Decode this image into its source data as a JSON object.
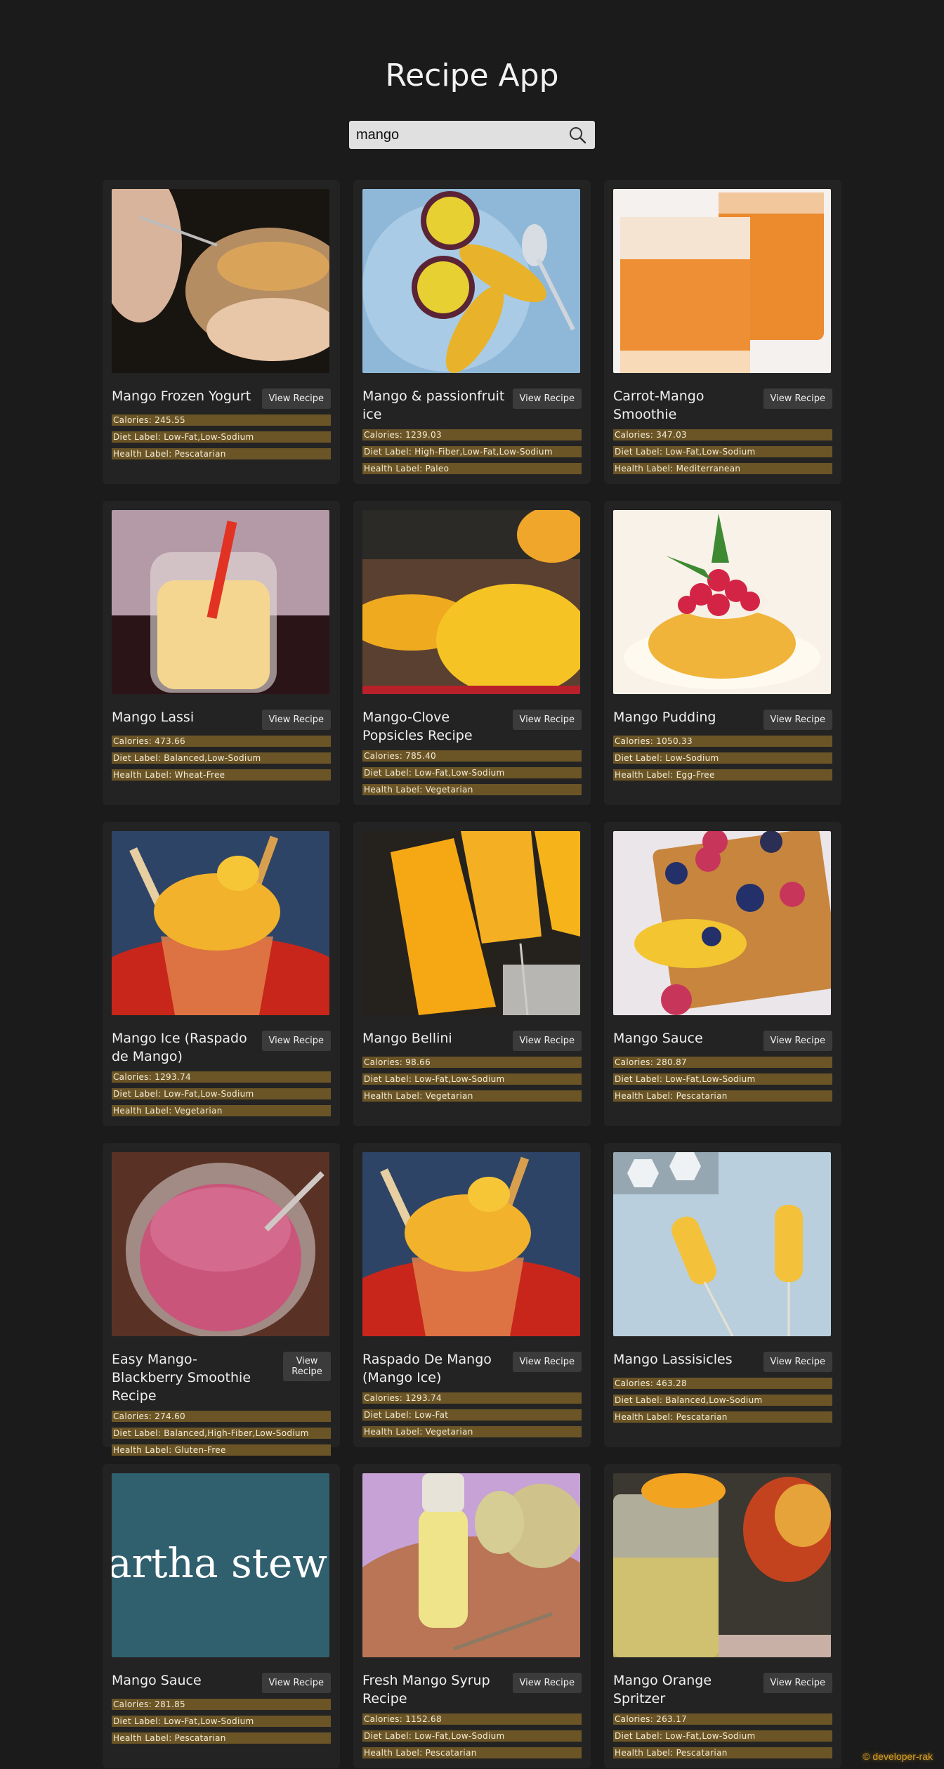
{
  "app": {
    "title": "Recipe App"
  },
  "search": {
    "value": "mango"
  },
  "colors": {
    "background": "#1b1b1b",
    "card": "#232323",
    "label_bg": "#6b5526",
    "button": "#3b3b3b",
    "footer": "#d8a021"
  },
  "recipes": [
    {
      "name": "Mango Frozen Yogurt",
      "button": "View Recipe",
      "calories": "Calories: 245.55",
      "diet": "Diet Label: Low-Fat,Low-Sodium",
      "health": "Health Label: Pescatarian"
    },
    {
      "name": "Mango & passionfruit ice",
      "button": "View Recipe",
      "calories": "Calories: 1239.03",
      "diet": "Diet Label: High-Fiber,Low-Fat,Low-Sodium",
      "health": "Health Label: Paleo"
    },
    {
      "name": "Carrot-Mango Smoothie",
      "button": "View Recipe",
      "calories": "Calories: 347.03",
      "diet": "Diet Label: Low-Fat,Low-Sodium",
      "health": "Health Label: Mediterranean"
    },
    {
      "name": "Mango Lassi",
      "button": "View Recipe",
      "calories": "Calories: 473.66",
      "diet": "Diet Label: Balanced,Low-Sodium",
      "health": "Health Label: Wheat-Free"
    },
    {
      "name": "Mango-Clove Popsicles Recipe",
      "button": "View Recipe",
      "calories": "Calories: 785.40",
      "diet": "Diet Label: Low-Fat,Low-Sodium",
      "health": "Health Label: Vegetarian"
    },
    {
      "name": "Mango Pudding",
      "button": "View Recipe",
      "calories": "Calories: 1050.33",
      "diet": "Diet Label: Low-Sodium",
      "health": "Health Label: Egg-Free"
    },
    {
      "name": "Mango Ice (Raspado de Mango)",
      "button": "View Recipe",
      "calories": "Calories: 1293.74",
      "diet": "Diet Label: Low-Fat,Low-Sodium",
      "health": "Health Label: Vegetarian"
    },
    {
      "name": "Mango Bellini",
      "button": "View Recipe",
      "calories": "Calories: 98.66",
      "diet": "Diet Label: Low-Fat,Low-Sodium",
      "health": "Health Label: Vegetarian"
    },
    {
      "name": "Mango Sauce",
      "button": "View Recipe",
      "calories": "Calories: 280.87",
      "diet": "Diet Label: Low-Fat,Low-Sodium",
      "health": "Health Label: Pescatarian"
    },
    {
      "name": "Easy Mango-Blackberry Smoothie Recipe",
      "button": "View Recipe",
      "calories": "Calories: 274.60",
      "diet": "Diet Label: Balanced,High-Fiber,Low-Sodium",
      "health": "Health Label: Gluten-Free"
    },
    {
      "name": "Raspado De Mango (Mango Ice)",
      "button": "View Recipe",
      "calories": "Calories: 1293.74",
      "diet": "Diet Label: Low-Fat",
      "health": "Health Label: Vegetarian"
    },
    {
      "name": "Mango Lassisicles",
      "button": "View Recipe",
      "calories": "Calories: 463.28",
      "diet": "Diet Label: Balanced,Low-Sodium",
      "health": "Health Label: Pescatarian"
    },
    {
      "name": "Mango Sauce",
      "button": "View Recipe",
      "calories": "Calories: 281.85",
      "diet": "Diet Label: Low-Fat,Low-Sodium",
      "health": "Health Label: Pescatarian",
      "image_text": "artha stewa"
    },
    {
      "name": "Fresh Mango Syrup Recipe",
      "button": "View Recipe",
      "calories": "Calories: 1152.68",
      "diet": "Diet Label: Low-Fat,Low-Sodium",
      "health": "Health Label: Pescatarian"
    },
    {
      "name": "Mango Orange Spritzer",
      "button": "View Recipe",
      "calories": "Calories: 263.17",
      "diet": "Diet Label: Low-Fat,Low-Sodium",
      "health": "Health Label: Pescatarian"
    }
  ],
  "footer": {
    "credit": "© developer-rak"
  }
}
